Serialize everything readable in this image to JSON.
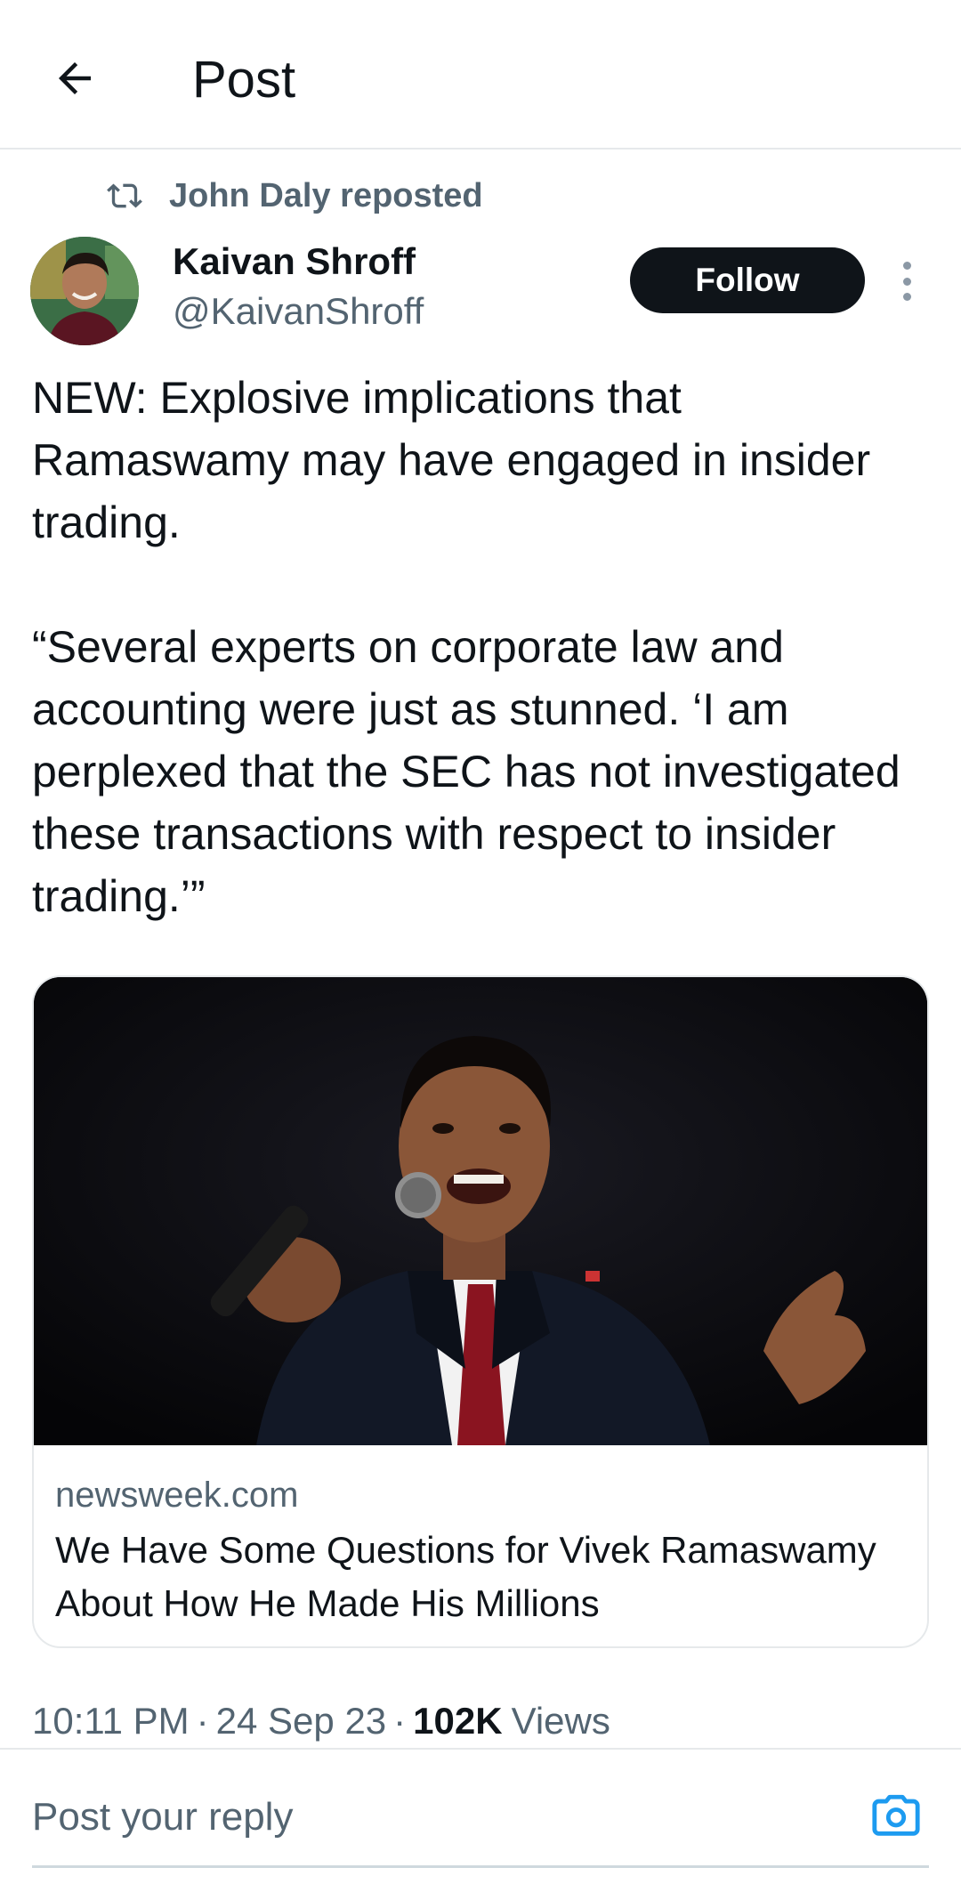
{
  "header": {
    "title": "Post",
    "back_icon": "arrow-left-icon"
  },
  "repost": {
    "text": "John Daly reposted",
    "icon": "repost-icon"
  },
  "author": {
    "name": "Kaivan Shroff",
    "handle": "@KaivanShroff",
    "follow_label": "Follow"
  },
  "post": {
    "text": "NEW: Explosive implications that Ramaswamy may have engaged in insider trading.\n\n“Several experts on corporate law and accounting were just as stunned. ‘I am perplexed that the SEC has not investigated these transactions with respect to insider trading.’”"
  },
  "link_card": {
    "domain": "newsweek.com",
    "title": "We Have Some Questions for Vivek Ramaswamy About How He Made His Millions"
  },
  "meta": {
    "time": "10:11 PM",
    "separator": "·",
    "date": "24 Sep 23",
    "views_count": "102K",
    "views_label": "Views"
  },
  "reply": {
    "placeholder": "Post your reply",
    "camera_icon": "camera-icon"
  },
  "colors": {
    "text_primary": "#0f1419",
    "text_secondary": "#536471",
    "accent": "#1d9bf0",
    "follow_bg": "#0f1419"
  }
}
